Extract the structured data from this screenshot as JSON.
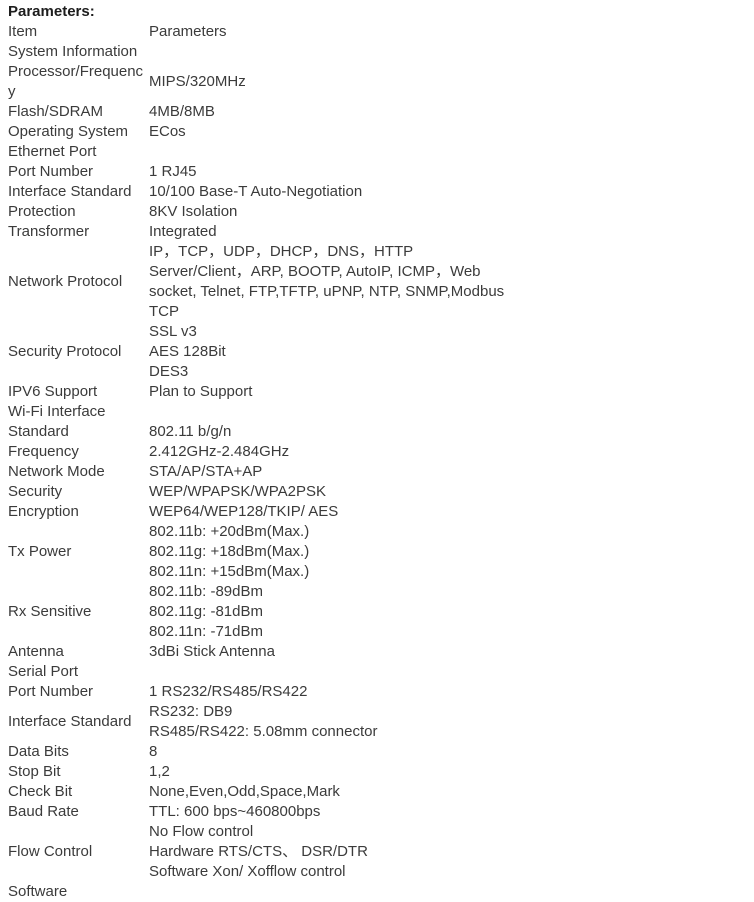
{
  "document": {
    "title": "Parameters:"
  },
  "table": {
    "columns": [
      "Item",
      "Parameters"
    ],
    "rows": [
      {
        "kind": "header",
        "item": "Item",
        "param": "Parameters"
      },
      {
        "kind": "section",
        "item": "System Information",
        "param": ""
      },
      {
        "kind": "data",
        "item": "Processor/Frequency",
        "param": "MIPS/320MHz"
      },
      {
        "kind": "data",
        "item": "Flash/SDRAM",
        "param": "4MB/8MB"
      },
      {
        "kind": "data",
        "item": "Operating System",
        "param": "ECos"
      },
      {
        "kind": "section",
        "item": "Ethernet Port",
        "param": ""
      },
      {
        "kind": "data",
        "item": "Port Number",
        "param": "1 RJ45"
      },
      {
        "kind": "data",
        "item": "Interface Standard",
        "param": "10/100 Base-T Auto-Negotiation"
      },
      {
        "kind": "data",
        "item": "Protection",
        "param": "8KV Isolation"
      },
      {
        "kind": "data",
        "item": "Transformer",
        "param": "Integrated"
      },
      {
        "kind": "data",
        "item": "Network Protocol",
        "param": "IP，TCP，UDP，DHCP，DNS，HTTP\nServer/Client，ARP, BOOTP, AutoIP, ICMP，Web\nsocket, Telnet, FTP,TFTP, uPNP, NTP, SNMP,Modbus\nTCP"
      },
      {
        "kind": "data",
        "item": "Security Protocol",
        "param": "SSL v3\nAES 128Bit\nDES3"
      },
      {
        "kind": "data",
        "item": "IPV6 Support",
        "param": "Plan to Support"
      },
      {
        "kind": "section",
        "item": "Wi-Fi Interface",
        "param": ""
      },
      {
        "kind": "data",
        "item": "Standard",
        "param": "802.11 b/g/n"
      },
      {
        "kind": "data",
        "item": "Frequency",
        "param": "2.412GHz-2.484GHz"
      },
      {
        "kind": "data",
        "item": "Network Mode",
        "param": "STA/AP/STA+AP"
      },
      {
        "kind": "data",
        "item": "Security",
        "param": "WEP/WPAPSK/WPA2PSK"
      },
      {
        "kind": "data",
        "item": "Encryption",
        "param": "WEP64/WEP128/TKIP/ AES"
      },
      {
        "kind": "data",
        "item": "Tx Power",
        "param": "802.11b: +20dBm(Max.)\n802.11g: +18dBm(Max.)\n802.11n: +15dBm(Max.)"
      },
      {
        "kind": "data",
        "item": "Rx Sensitive",
        "param": "802.11b: -89dBm\n802.11g: -81dBm\n802.11n: -71dBm"
      },
      {
        "kind": "data",
        "item": "Antenna",
        "param": "3dBi Stick Antenna"
      },
      {
        "kind": "section",
        "item": "Serial Port",
        "param": ""
      },
      {
        "kind": "data",
        "item": "Port Number",
        "param": "1 RS232/RS485/RS422"
      },
      {
        "kind": "data",
        "item": "Interface Standard",
        "param": "RS232: DB9\nRS485/RS422: 5.08mm connector"
      },
      {
        "kind": "data",
        "item": "Data Bits",
        "param": "8"
      },
      {
        "kind": "data",
        "item": "Stop Bit",
        "param": "1,2"
      },
      {
        "kind": "data",
        "item": "Check Bit",
        "param": "None,Even,Odd,Space,Mark"
      },
      {
        "kind": "data",
        "item": "Baud Rate",
        "param": "TTL: 600 bps~460800bps"
      },
      {
        "kind": "data",
        "item": "Flow Control",
        "param": "No Flow control\nHardware RTS/CTS、 DSR/DTR\nSoftware Xon/ Xofflow control"
      },
      {
        "kind": "section",
        "item": "Software",
        "param": ""
      }
    ]
  },
  "style": {
    "text_color": "#3b3b3b",
    "title_color": "#1d1d1d",
    "background": "#ffffff"
  }
}
